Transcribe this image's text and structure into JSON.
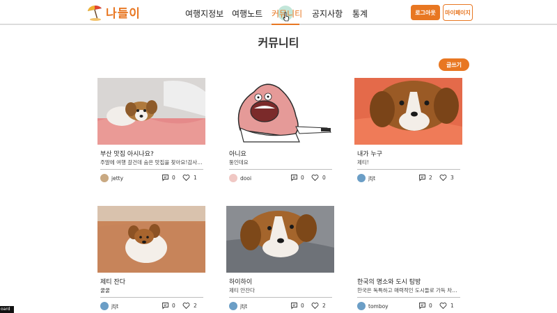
{
  "header": {
    "logo_text": "나들이",
    "nav": [
      {
        "label": "여행지정보"
      },
      {
        "label": "여행노트"
      },
      {
        "label": "커뮤니티",
        "active": true
      },
      {
        "label": "공지사항"
      },
      {
        "label": "통계"
      }
    ],
    "login_label": "로그아웃",
    "mypage_label": "마이페이지"
  },
  "page": {
    "title": "커뮤니티",
    "write_label": "글쓰기"
  },
  "posts": [
    {
      "title": "부산 맛집 아시나요?",
      "desc": "주말에 여행 갈건데 숨은 맛집을 찾아요!감사합니다",
      "author": "jetty",
      "comments": "0",
      "likes": "1",
      "image": "dog-on-bed"
    },
    {
      "title": "아니요",
      "desc": "뚱인데요",
      "author": "dooi",
      "comments": "0",
      "likes": "0",
      "image": "cartoon-starfish"
    },
    {
      "title": "내가 누구",
      "desc": "제티!",
      "author": "jtjt",
      "comments": "2",
      "likes": "3",
      "image": "dog-closeup"
    },
    {
      "title": "제티 잔다",
      "desc": "쿨쿨",
      "author": "jtjt",
      "comments": "0",
      "likes": "2",
      "image": "dog-sleeping"
    },
    {
      "title": "하이하이",
      "desc": "제티 안잔다",
      "author": "jtjt",
      "comments": "0",
      "likes": "2",
      "image": "dog-on-blanket"
    },
    {
      "title": "한국의 명소와 도시 탐방",
      "desc": "한국은 독특하고 매력적인 도시들로 가득 차있습니다",
      "author": "tomboy",
      "comments": "0",
      "likes": "1",
      "image": "none"
    }
  ],
  "corner_tag": "oard",
  "colors": {
    "accent": "#e87722"
  }
}
